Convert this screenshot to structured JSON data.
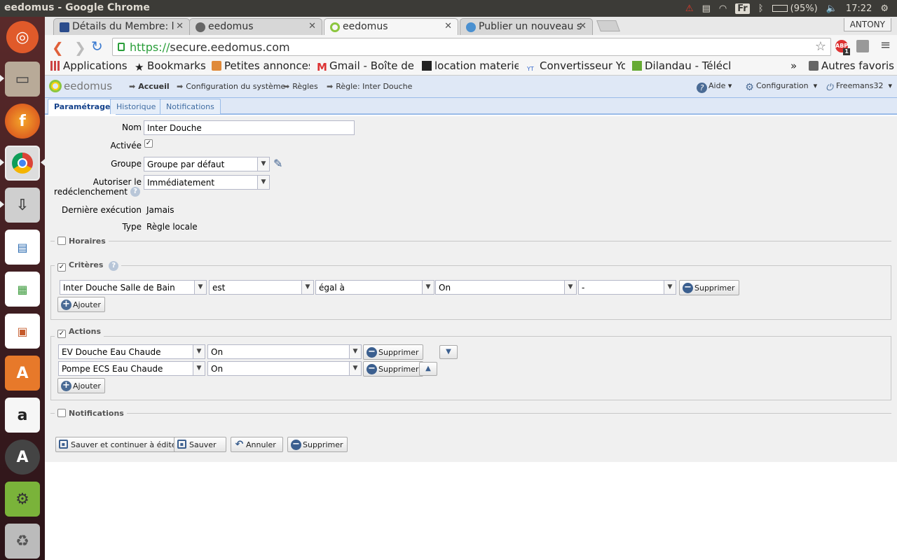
{
  "window": {
    "title": "eedomus - Google Chrome"
  },
  "system_tray": {
    "battery": "(95%)",
    "time": "17:22",
    "keyboard": "Fr"
  },
  "browser": {
    "tabs": [
      {
        "label": "Détails du Membre: l",
        "active": false
      },
      {
        "label": "eedomus",
        "active": false
      },
      {
        "label": "eedomus",
        "active": true
      },
      {
        "label": "Publier un nouveau s",
        "active": false
      }
    ],
    "user": "ANTONY",
    "url_scheme": "https://",
    "url_host": "secure.eedomus.com",
    "abp_badge": "1",
    "bookmarks": [
      {
        "label": "Applications"
      },
      {
        "label": "Bookmarks"
      },
      {
        "label": "Petites annonces"
      },
      {
        "label": "Gmail - Boîte de r"
      },
      {
        "label": "location materiel"
      },
      {
        "label": "Convertisseur Yo"
      },
      {
        "label": "Dilandau - Téléch"
      }
    ],
    "other_bookmarks": "Autres favoris",
    "more": "»"
  },
  "app": {
    "logo": "eedomus",
    "breadcrumb": [
      "Accueil",
      "Configuration du système",
      "Règles",
      "Règle: Inter Douche"
    ],
    "menu": {
      "help": "Aide",
      "config": "Configuration",
      "user": "Freemans32"
    },
    "tabs": [
      "Paramétrage",
      "Historique",
      "Notifications"
    ]
  },
  "form": {
    "name_label": "Nom",
    "name_value": "Inter Douche",
    "active_label": "Activée",
    "group_label": "Groupe",
    "group_value": "Groupe par défaut",
    "retrigger_label_1": "Autoriser le",
    "retrigger_label_2": "redéclenchement",
    "retrigger_value": "Immédiatement",
    "last_exec_label": "Dernière exécution",
    "last_exec_value": "Jamais",
    "type_label": "Type",
    "type_value": "Règle locale",
    "horaires": "Horaires",
    "criteres": "Critères",
    "criteria": [
      {
        "device": "Inter Douche Salle de Bain",
        "op": "est",
        "cmp": "égal à",
        "value": "On",
        "extra": "-"
      }
    ],
    "actions_title": "Actions",
    "actions": [
      {
        "device": "EV Douche Eau Chaude",
        "value": "On"
      },
      {
        "device": "Pompe ECS Eau Chaude",
        "value": "On"
      }
    ],
    "notifications": "Notifications",
    "delete": "Supprimer",
    "add": "Ajouter",
    "footer": {
      "save_continue": "Sauver et continuer à éditer",
      "save": "Sauver",
      "cancel": "Annuler",
      "delete": "Supprimer"
    }
  }
}
